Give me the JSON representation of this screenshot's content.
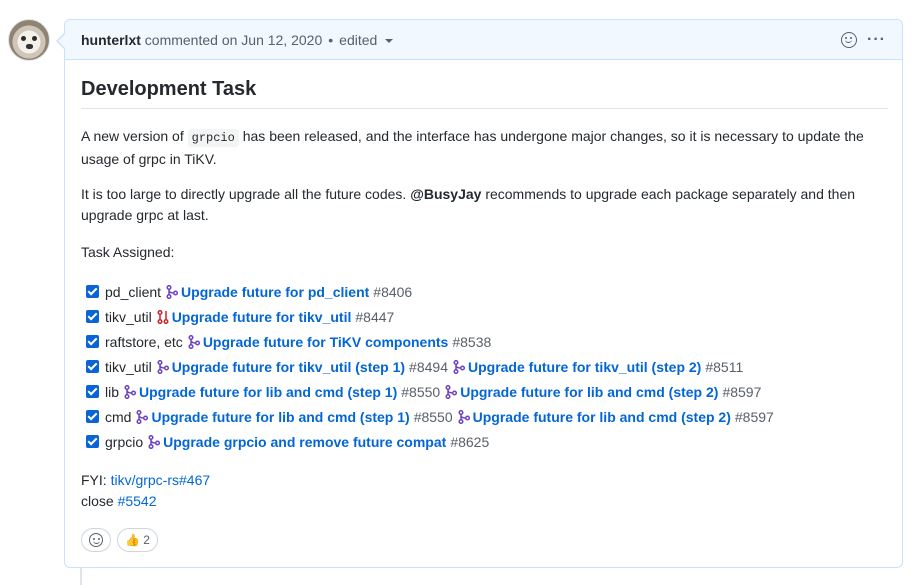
{
  "comment": {
    "author": "hunterlxt",
    "action": "commented on Jun 12, 2020",
    "separator": "•",
    "edited": "edited",
    "more_label": "···"
  },
  "content": {
    "title": "Development Task",
    "para1_before": "A new version of ",
    "para1_code": "grpcio",
    "para1_after": " has been released, and the interface has undergone major changes, so it is necessary to update the usage of grpc in TiKV.",
    "para2_before": "It is too large to directly upgrade all the future codes. ",
    "para2_mention": "@BusyJay",
    "para2_after": " recommends to upgrade each package separately and then upgrade grpc at last.",
    "tasks_heading": "Task Assigned:",
    "fyi_label": "FYI: ",
    "fyi_link": "tikv/grpc-rs#467",
    "close_label": "close ",
    "close_link": "#5542"
  },
  "tasks": [
    {
      "label": "pd_client",
      "prs": [
        {
          "title": "Upgrade future for pd_client",
          "num": "#8406",
          "state": "merged"
        }
      ]
    },
    {
      "label": "tikv_util",
      "prs": [
        {
          "title": "Upgrade future for tikv_util",
          "num": "#8447",
          "state": "closed"
        }
      ]
    },
    {
      "label": "raftstore, etc",
      "prs": [
        {
          "title": "Upgrade future for TiKV components",
          "num": "#8538",
          "state": "merged"
        }
      ]
    },
    {
      "label": "tikv_util",
      "prs": [
        {
          "title": "Upgrade future for tikv_util (step 1)",
          "num": "#8494",
          "state": "merged"
        },
        {
          "title": "Upgrade future for tikv_util (step 2)",
          "num": "#8511",
          "state": "merged"
        }
      ]
    },
    {
      "label": "lib",
      "prs": [
        {
          "title": "Upgrade future for lib and cmd (step 1)",
          "num": "#8550",
          "state": "merged"
        },
        {
          "title": "Upgrade future for lib and cmd (step 2)",
          "num": "#8597",
          "state": "merged"
        }
      ]
    },
    {
      "label": "cmd",
      "prs": [
        {
          "title": "Upgrade future for lib and cmd (step 1)",
          "num": "#8550",
          "state": "merged"
        },
        {
          "title": "Upgrade future for lib and cmd (step 2)",
          "num": "#8597",
          "state": "merged"
        }
      ]
    },
    {
      "label": "grpcio",
      "prs": [
        {
          "title": "Upgrade grpcio and remove future compat",
          "num": "#8625",
          "state": "merged"
        }
      ]
    }
  ],
  "reactions": {
    "thumbs_emoji": "👍",
    "thumbs_count": "2"
  },
  "colors": {
    "merged": "#6f42c1",
    "closed": "#cb2431",
    "link": "#0366d6"
  }
}
